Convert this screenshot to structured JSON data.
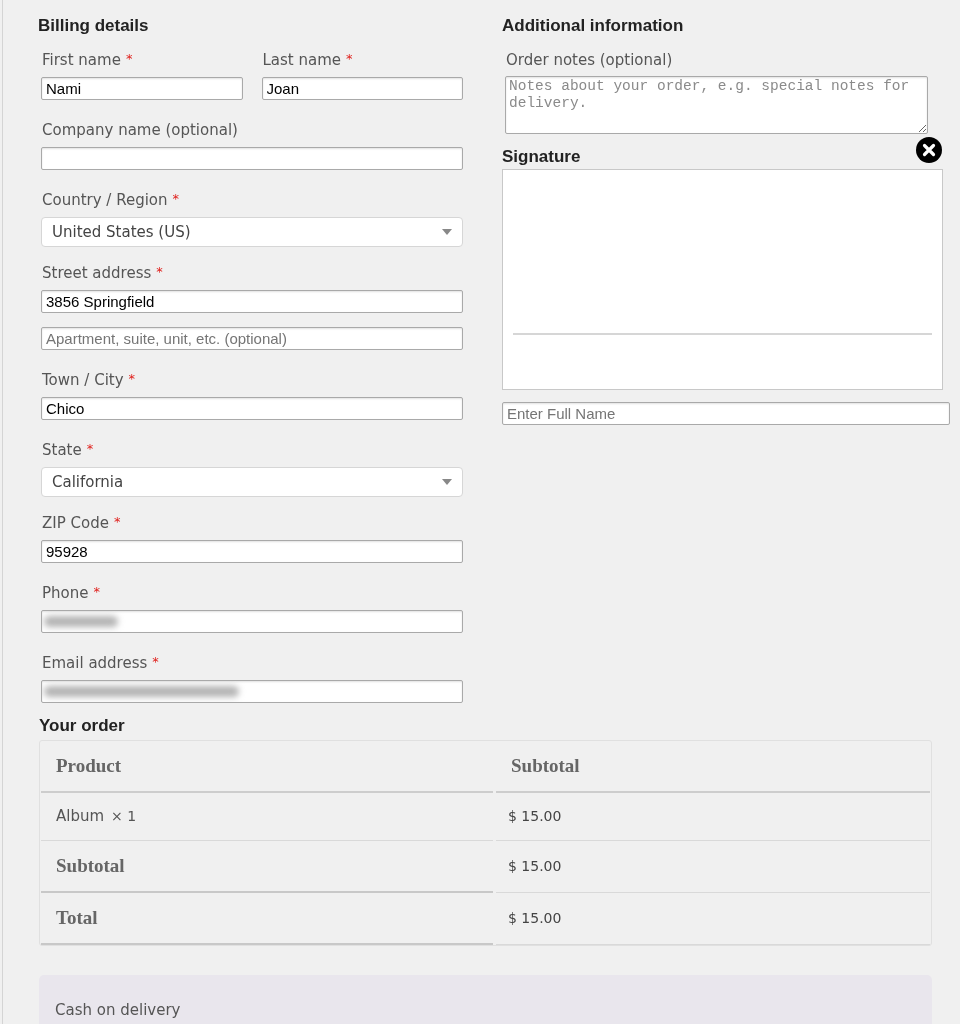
{
  "billing": {
    "title": "Billing details",
    "rows": [
      {
        "kind": "pair",
        "fields": [
          {
            "label": "First name",
            "required_mark": "*",
            "value": "Nami"
          },
          {
            "label": "Last name",
            "required_mark": "*",
            "value": "Joan"
          }
        ]
      },
      {
        "kind": "text",
        "label": "Company name (optional)"
      },
      {
        "kind": "select",
        "label": "Country / Region",
        "required_mark": "*",
        "value": "United States (US)"
      },
      {
        "kind": "text",
        "label": "Street address",
        "required_mark": "*",
        "value": "3856 Springfield"
      },
      {
        "kind": "text",
        "placeholder": "Apartment, suite, unit, etc. (optional)"
      },
      {
        "kind": "text",
        "label": "Town / City",
        "required_mark": "*",
        "value": "Chico"
      },
      {
        "kind": "select",
        "label": "State",
        "required_mark": "*",
        "value": "California"
      },
      {
        "kind": "text",
        "label": "ZIP Code",
        "required_mark": "*",
        "value": "95928"
      },
      {
        "kind": "phone",
        "label": "Phone",
        "required_mark": "*",
        "redacted": true
      },
      {
        "kind": "email",
        "label": "Email address",
        "required_mark": "*",
        "redacted": true
      }
    ]
  },
  "additional": {
    "title": "Additional information",
    "notes": {
      "label": "Order notes (optional)",
      "placeholder": "Notes about your order, e.g. special notes for delivery."
    },
    "signature": {
      "title": "Signature",
      "name_placeholder": "Enter Full Name"
    }
  },
  "order": {
    "title": "Your order",
    "columns": [
      "Product",
      "Subtotal"
    ],
    "rows": [
      {
        "kind": "item",
        "product": "Album",
        "quantity": "× 1",
        "subtotal": "$ 15.00"
      },
      {
        "kind": "total",
        "label": "Subtotal",
        "value": "$ 15.00"
      },
      {
        "kind": "total",
        "label": "Total",
        "value": "$ 15.00"
      }
    ]
  },
  "payment": {
    "methods": [
      {
        "label": "Cash on delivery"
      }
    ]
  }
}
